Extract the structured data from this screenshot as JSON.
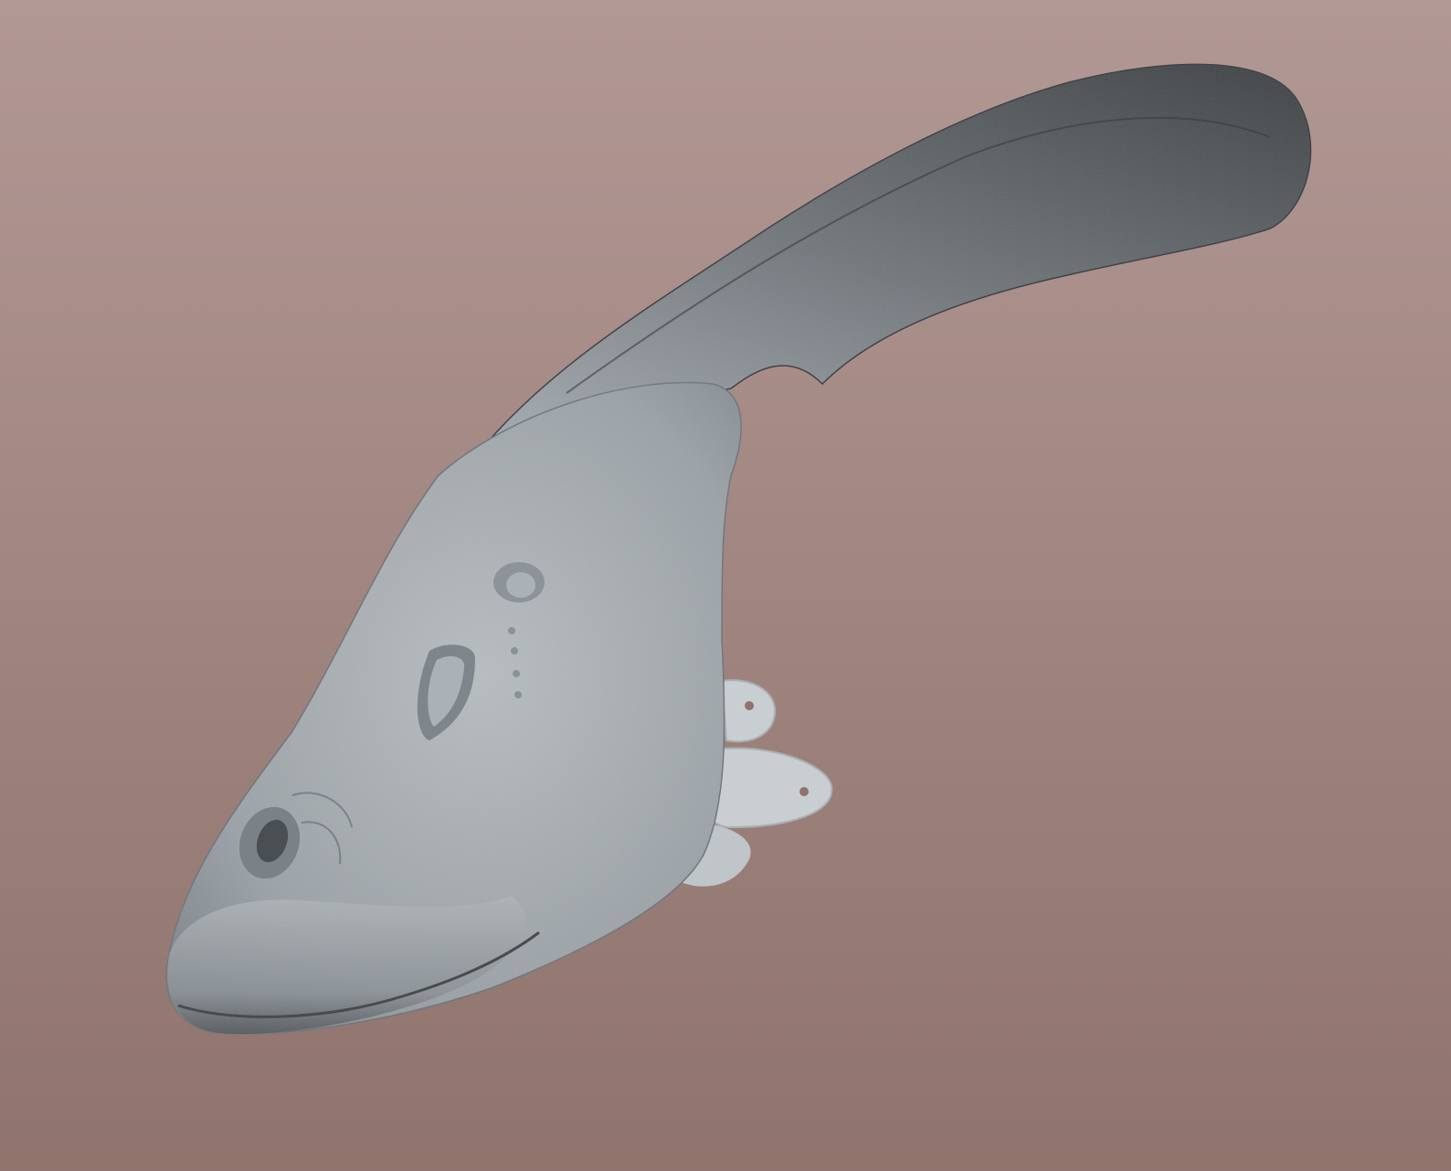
{
  "scene": {
    "subject": "parasaurolophus-head-mask-3d-render",
    "colors": {
      "background_top": "#b29894",
      "background_bottom": "#8f736c",
      "skin_light": "#b7bdc0",
      "skin_mid": "#9aa1a6",
      "skin_dark": "#4d5155",
      "crest_dark": "#3e4245",
      "strap": "#c9ced2",
      "hole_inner": "#aab2b8"
    }
  }
}
